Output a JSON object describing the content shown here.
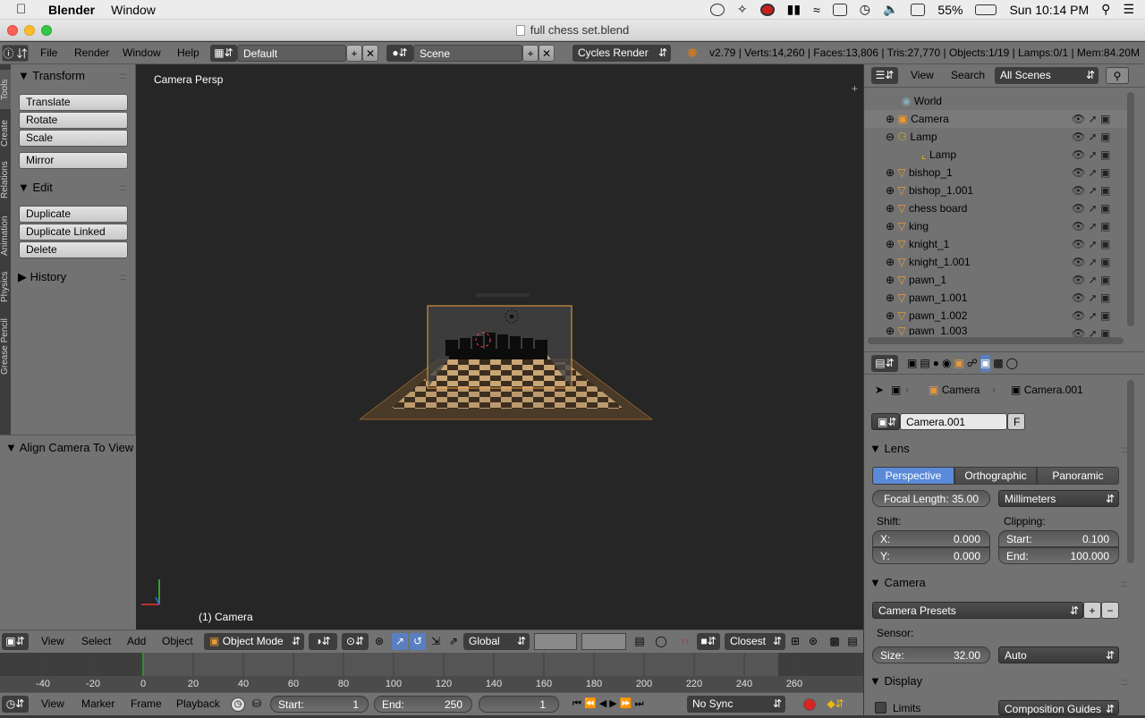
{
  "menubar": {
    "app_name": "Blender",
    "items": [
      "Window"
    ],
    "battery": "55%",
    "clock": "Sun 10:14 PM"
  },
  "window": {
    "title": "full chess set.blend"
  },
  "topheader": {
    "menus": [
      "File",
      "Render",
      "Window",
      "Help"
    ],
    "layout": "Default",
    "scene": "Scene",
    "engine": "Cycles Render",
    "stats": "v2.79 | Verts:14,260 | Faces:13,806 | Tris:27,770 | Objects:1/19 | Lamps:0/1 | Mem:84.20M"
  },
  "tabs": [
    "Tools",
    "Create",
    "Relations",
    "Animation",
    "Physics",
    "Grease Pencil"
  ],
  "toolshelf": {
    "transform_title": "Transform",
    "transform_buttons": [
      "Translate",
      "Rotate",
      "Scale"
    ],
    "mirror": "Mirror",
    "edit_title": "Edit",
    "edit_buttons": [
      "Duplicate",
      "Duplicate Linked",
      "Delete"
    ],
    "history_title": "History",
    "operator_title": "Align Camera To View"
  },
  "viewport": {
    "view_label": "Camera Persp",
    "object_label": "(1) Camera"
  },
  "vpheader": {
    "menus": [
      "View",
      "Select",
      "Add",
      "Object"
    ],
    "mode": "Object Mode",
    "orientation": "Global",
    "snap": "Closest"
  },
  "timeline": {
    "ticks": [
      "-40",
      "-20",
      "0",
      "20",
      "40",
      "60",
      "80",
      "100",
      "120",
      "140",
      "160",
      "180",
      "200",
      "220",
      "240",
      "260"
    ],
    "current_frame_marker": 0,
    "menus": [
      "View",
      "Marker",
      "Frame",
      "Playback"
    ],
    "start_label": "Start:",
    "start_value": "1",
    "end_label": "End:",
    "end_value": "250",
    "current_frame": "1",
    "sync": "No Sync"
  },
  "outliner": {
    "menus": [
      "View",
      "Search"
    ],
    "filter": "All Scenes",
    "rows": [
      "World",
      "Camera",
      "Lamp",
      "Lamp",
      "bishop_1",
      "bishop_1.001",
      "chess board",
      "king",
      "knight_1",
      "knight_1.001",
      "pawn_1",
      "pawn_1.001",
      "pawn_1.002",
      "pawn_1.003"
    ]
  },
  "properties": {
    "breadcrumb_object": "Camera",
    "breadcrumb_data": "Camera.001",
    "datablock": "Camera.001",
    "fake_user": "F",
    "lens_title": "Lens",
    "lens_types": [
      "Perspective",
      "Orthographic",
      "Panoramic"
    ],
    "lens_active": "Perspective",
    "focal_length": "Focal Length: 35.00",
    "lens_unit": "Millimeters",
    "shift_label": "Shift:",
    "clipping_label": "Clipping:",
    "shift_x_label": "X:",
    "shift_x": "0.000",
    "shift_y_label": "Y:",
    "shift_y": "0.000",
    "clip_start_label": "Start:",
    "clip_start": "0.100",
    "clip_end_label": "End:",
    "clip_end": "100.000",
    "camera_title": "Camera",
    "camera_presets": "Camera Presets",
    "sensor_label": "Sensor:",
    "sensor_size_label": "Size:",
    "sensor_size": "32.00",
    "sensor_fit": "Auto",
    "display_title": "Display",
    "limits_label": "Limits",
    "composition_guides": "Composition Guides"
  }
}
